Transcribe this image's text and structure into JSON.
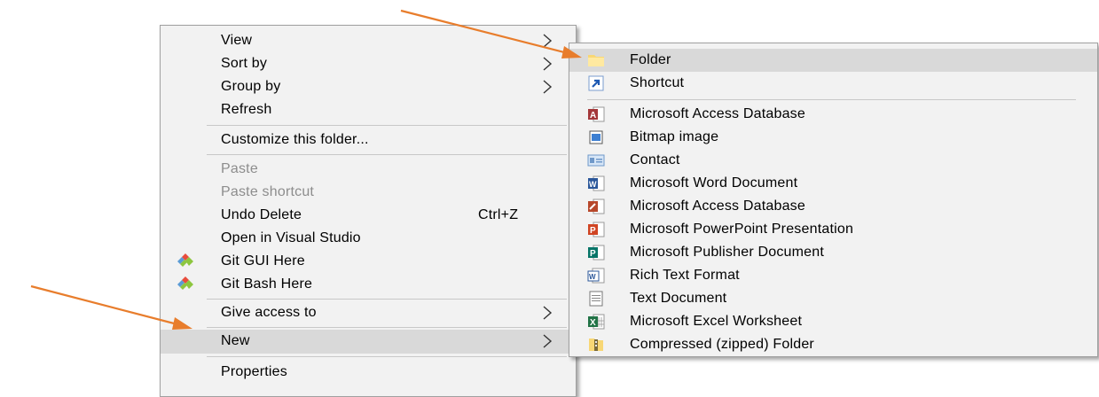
{
  "context_menu": {
    "items": [
      {
        "label": "View"
      },
      {
        "label": "Sort by"
      },
      {
        "label": "Group by"
      },
      {
        "label": "Refresh"
      },
      {
        "label": "Customize this folder..."
      },
      {
        "label": "Paste"
      },
      {
        "label": "Paste shortcut"
      },
      {
        "label": "Undo Delete",
        "shortcut": "Ctrl+Z"
      },
      {
        "label": "Open in Visual Studio"
      },
      {
        "label": "Git GUI Here"
      },
      {
        "label": "Git Bash Here"
      },
      {
        "label": "Give access to"
      },
      {
        "label": "New"
      },
      {
        "label": "Properties"
      }
    ]
  },
  "new_submenu": {
    "items": [
      {
        "label": "Folder"
      },
      {
        "label": "Shortcut"
      },
      {
        "label": "Microsoft Access Database"
      },
      {
        "label": "Bitmap image"
      },
      {
        "label": "Contact"
      },
      {
        "label": "Microsoft Word Document"
      },
      {
        "label": "Microsoft Access Database"
      },
      {
        "label": "Microsoft PowerPoint Presentation"
      },
      {
        "label": "Microsoft Publisher Document"
      },
      {
        "label": "Rich Text Format"
      },
      {
        "label": "Text Document"
      },
      {
        "label": "Microsoft Excel Worksheet"
      },
      {
        "label": "Compressed (zipped) Folder"
      }
    ]
  },
  "colors": {
    "annotation_arrow": "#e87d2c",
    "menu_background": "#f2f2f2",
    "highlight": "#d9d9d9",
    "disabled_text": "#8d8d8d"
  }
}
